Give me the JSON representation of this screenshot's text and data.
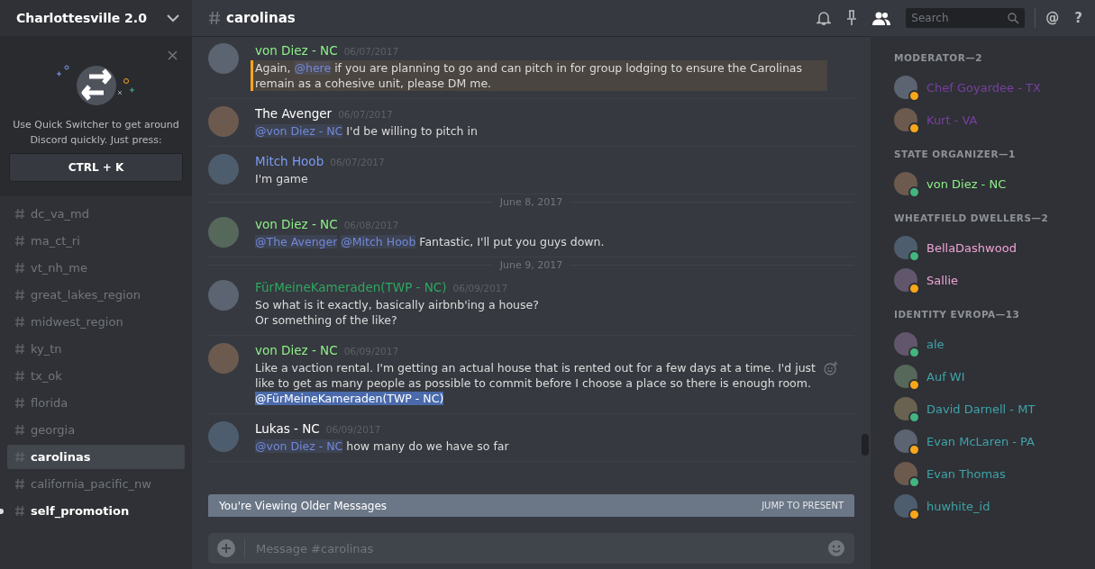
{
  "server": {
    "name": "Charlottesville 2.0"
  },
  "quick_switcher": {
    "text": "Use Quick Switcher to get around Discord quickly. Just press:",
    "shortcut": "CTRL + K"
  },
  "channels": [
    {
      "name": "dc_va_md",
      "selected": false,
      "unread": false
    },
    {
      "name": "ma_ct_ri",
      "selected": false,
      "unread": false
    },
    {
      "name": "vt_nh_me",
      "selected": false,
      "unread": false
    },
    {
      "name": "great_lakes_region",
      "selected": false,
      "unread": false
    },
    {
      "name": "midwest_region",
      "selected": false,
      "unread": false
    },
    {
      "name": "ky_tn",
      "selected": false,
      "unread": false
    },
    {
      "name": "tx_ok",
      "selected": false,
      "unread": false
    },
    {
      "name": "florida",
      "selected": false,
      "unread": false
    },
    {
      "name": "georgia",
      "selected": false,
      "unread": false
    },
    {
      "name": "carolinas",
      "selected": true,
      "unread": false
    },
    {
      "name": "california_pacific_nw",
      "selected": false,
      "unread": false
    },
    {
      "name": "self_promotion",
      "selected": false,
      "unread": true
    }
  ],
  "channel_header": {
    "name": "carolinas",
    "search_placeholder": "Search",
    "mentions": "@",
    "help": "?"
  },
  "messages": [
    {
      "kind": "message",
      "author": "von Diez - NC",
      "color": "#8ef08a",
      "time": "06/07/2017",
      "highlighted": true,
      "reaction": false,
      "lines": [
        [
          {
            "kind": "text",
            "text": "Again, "
          },
          {
            "kind": "mention",
            "text": "@here"
          },
          {
            "kind": "text",
            "text": "  if you are planning to go and can pitch in for group lodging to ensure the Carolinas remain as a cohesive unit, please DM me."
          }
        ]
      ]
    },
    {
      "kind": "message",
      "author": "The Avenger",
      "color": "#ffffff",
      "time": "06/07/2017",
      "highlighted": false,
      "reaction": false,
      "lines": [
        [
          {
            "kind": "mention",
            "text": "@von Diez - NC"
          },
          {
            "kind": "text",
            "text": " I'd be willing to pitch in"
          }
        ]
      ]
    },
    {
      "kind": "message",
      "author": "Mitch Hoob",
      "color": "#7b9cf5",
      "time": "06/07/2017",
      "highlighted": false,
      "reaction": false,
      "lines": [
        [
          {
            "kind": "text",
            "text": "I'm game"
          }
        ]
      ]
    },
    {
      "kind": "divider",
      "text": "June 8, 2017"
    },
    {
      "kind": "message",
      "author": "von Diez - NC",
      "color": "#8ef08a",
      "time": "06/08/2017",
      "highlighted": false,
      "reaction": false,
      "lines": [
        [
          {
            "kind": "mention",
            "text": "@The Avenger"
          },
          {
            "kind": "mention",
            "text": "@Mitch Hoob"
          },
          {
            "kind": "text",
            "text": " Fantastic, I'll put you guys down."
          }
        ]
      ]
    },
    {
      "kind": "divider",
      "text": "June 9, 2017"
    },
    {
      "kind": "message",
      "author": "FürMeineKameraden(TWP - NC)",
      "color": "#2ea661",
      "time": "06/09/2017",
      "highlighted": false,
      "reaction": false,
      "lines": [
        [
          {
            "kind": "text",
            "text": "So what is it exactly, basically airbnb'ing a house?"
          }
        ],
        [
          {
            "kind": "text",
            "text": "Or something of the like?"
          }
        ]
      ]
    },
    {
      "kind": "message",
      "author": "von Diez - NC",
      "color": "#8ef08a",
      "time": "06/09/2017",
      "highlighted": false,
      "reaction": true,
      "lines": [
        [
          {
            "kind": "text",
            "text": "Like a vaction rental. I'm getting an actual house that is rented out for a few days at a time. I'd just like to get as many people as possible to commit before I choose a place so there is enough room. "
          },
          {
            "kind": "selected",
            "text": "@FürMeineKameraden(TWP - NC)"
          }
        ]
      ]
    },
    {
      "kind": "message",
      "author": "Lukas - NC",
      "color": "#ffffff",
      "time": "06/09/2017",
      "highlighted": false,
      "reaction": false,
      "lines": [
        [
          {
            "kind": "mention",
            "text": "@von Diez - NC"
          },
          {
            "kind": "text",
            "text": " how many do we have so far"
          }
        ]
      ]
    }
  ],
  "older_bar": {
    "text": "You're Viewing Older Messages",
    "action": "JUMP TO PRESENT"
  },
  "composer": {
    "placeholder": "Message #carolinas"
  },
  "member_groups": [
    {
      "title": "MODERATOR—2",
      "members": [
        {
          "name": "Chef Goyardee - TX",
          "color": "#7a3fa0",
          "idle": true
        },
        {
          "name": "Kurt - VA",
          "color": "#7a3fa0",
          "idle": true
        }
      ]
    },
    {
      "title": "STATE ORGANIZER—1",
      "members": [
        {
          "name": "von Diez - NC",
          "color": "#8ef08a",
          "idle": false
        }
      ]
    },
    {
      "title": "WHEATFIELD DWELLERS—2",
      "members": [
        {
          "name": "BellaDashwood",
          "color": "#f0a3d6",
          "idle": false
        },
        {
          "name": "Sallie",
          "color": "#f0a3d6",
          "idle": true
        }
      ]
    },
    {
      "title": "IDENTITY EVROPA—13",
      "members": [
        {
          "name": "ale",
          "color": "#3fa3a8",
          "idle": false
        },
        {
          "name": "Auf WI",
          "color": "#3fa3a8",
          "idle": true
        },
        {
          "name": "David Darnell - MT",
          "color": "#3fa3a8",
          "idle": false
        },
        {
          "name": "Evan McLaren - PA",
          "color": "#3fa3a8",
          "idle": true
        },
        {
          "name": "Evan Thomas",
          "color": "#3fa3a8",
          "idle": false
        },
        {
          "name": "huwhite_id",
          "color": "#3fa3a8",
          "idle": true
        }
      ]
    }
  ]
}
